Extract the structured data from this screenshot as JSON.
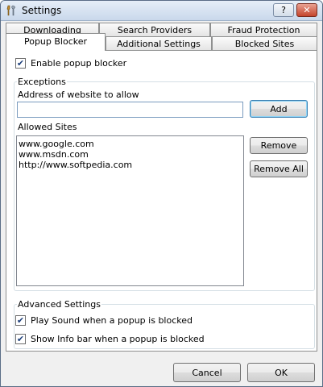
{
  "window": {
    "title": "Settings",
    "help_label": "?",
    "close_label": "✕"
  },
  "tabs": {
    "row1": [
      "Downloading",
      "Search Providers",
      "Fraud Protection"
    ],
    "row2": [
      "Popup Blocker",
      "Additional Settings",
      "Blocked Sites"
    ],
    "active": "Popup Blocker"
  },
  "popup": {
    "enable_label": "Enable popup blocker",
    "enable_checked": "✔"
  },
  "exceptions": {
    "legend": "Exceptions",
    "address_label": "Address of website to allow",
    "address_value": "",
    "add_label": "Add",
    "allowed_label": "Allowed Sites",
    "sites": [
      "www.google.com",
      "www.msdn.com",
      "http://www.softpedia.com"
    ],
    "remove_label": "Remove",
    "remove_all_label": "Remove All"
  },
  "advanced": {
    "legend": "Advanced Settings",
    "play_sound_label": "Play Sound when a popup is blocked",
    "play_sound_checked": "✔",
    "info_bar_label": "Show Info bar when a popup is blocked",
    "info_bar_checked": "✔"
  },
  "footer": {
    "cancel_label": "Cancel",
    "ok_label": "OK"
  },
  "colors": {
    "window_frame": "#5a6d86",
    "close_button": "#c4442c",
    "default_button_border": "#3c7fb1"
  }
}
